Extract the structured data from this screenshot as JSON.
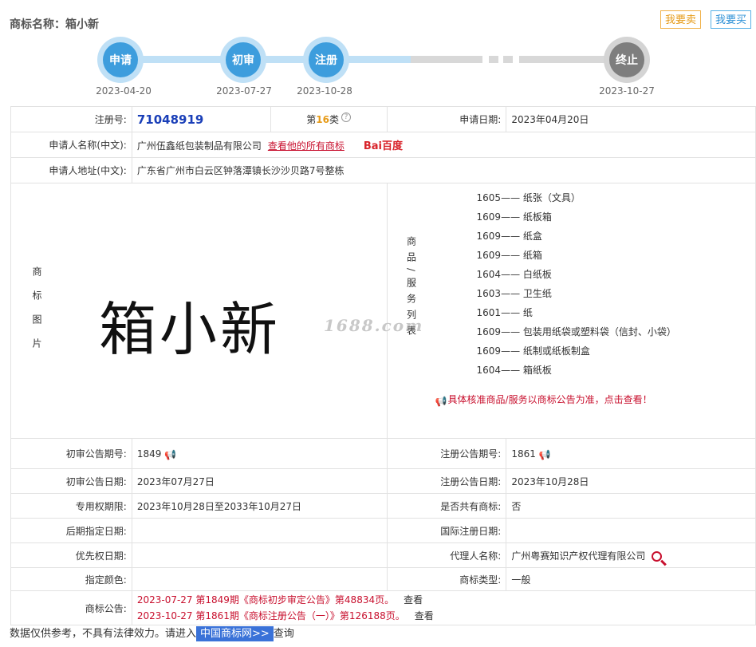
{
  "header": {
    "label": "商标名称：",
    "name": "箱小新",
    "sell_btn": "我要卖",
    "buy_btn": "我要买"
  },
  "progress": {
    "steps": [
      {
        "label": "申请",
        "date": "2023-04-20"
      },
      {
        "label": "初审",
        "date": "2023-07-27"
      },
      {
        "label": "注册",
        "date": "2023-10-28"
      },
      {
        "label": "终止",
        "date": "2023-10-27"
      }
    ]
  },
  "info": {
    "reg_no_label": "注册号:",
    "reg_no": "71048919",
    "class_prefix": "第",
    "class_no": "16",
    "class_suffix": "类",
    "help": "?",
    "apply_date_label": "申请日期:",
    "apply_date": "2023年04月20日",
    "applicant_label": "申请人名称(中文):",
    "applicant": "广州伍鑫纸包装制品有限公司",
    "view_all": "查看他的所有商标",
    "baidu": "Bai百度",
    "address_label": "申请人地址(中文):",
    "address": "广东省广州市白云区钟落潭镇长沙沙贝路7号整栋",
    "image_label": "商标图片",
    "trademark_text": "箱小新",
    "watermark": "1688.com",
    "goods_label": "商品/服务列表",
    "goods": [
      "1605—— 纸张（文具）",
      "1609—— 纸板箱",
      "1609—— 纸盒",
      "1609—— 纸箱",
      "1604—— 白纸板",
      "1603—— 卫生纸",
      "1601—— 纸",
      "1609—— 包装用纸袋或塑料袋（信封、小袋）",
      "1609—— 纸制或纸板制盒",
      "1604—— 箱纸板"
    ],
    "goods_note": "具体核准商品/服务以商标公告为准，点击查看！",
    "prelim_no_label": "初审公告期号:",
    "prelim_no": "1849",
    "reg_notice_no_label": "注册公告期号:",
    "reg_notice_no": "1861",
    "prelim_date_label": "初审公告日期:",
    "prelim_date": "2023年07月27日",
    "reg_notice_date_label": "注册公告日期:",
    "reg_notice_date": "2023年10月28日",
    "exclusive_label": "专用权期限:",
    "exclusive": "2023年10月28日至2033年10月27日",
    "shared_label": "是否共有商标:",
    "shared": "否",
    "later_label": "后期指定日期:",
    "later": "",
    "intl_label": "国际注册日期:",
    "intl": "",
    "priority_label": "优先权日期:",
    "priority": "",
    "agent_label": "代理人名称:",
    "agent": "广州粤赛知识产权代理有限公司",
    "color_label": "指定颜色:",
    "color": "",
    "type_label": "商标类型:",
    "type": "一般",
    "notice_label": "商标公告:",
    "notices": [
      {
        "text": "2023-07-27 第1849期《商标初步审定公告》第48834页。",
        "link": "查看"
      },
      {
        "text": "2023-10-27 第1861期《商标注册公告（一）》第126188页。",
        "link": "查看"
      }
    ]
  },
  "footer": {
    "prefix": "数据仅供参考，不具有法律效力。请进入",
    "link": "中国商标网>>",
    "suffix": "查询"
  },
  "colors": {
    "accent_blue": "#3d9ddd",
    "grey_step": "#7e7e7e",
    "notice_red": "#c8102e",
    "class_orange": "#e69a17"
  }
}
